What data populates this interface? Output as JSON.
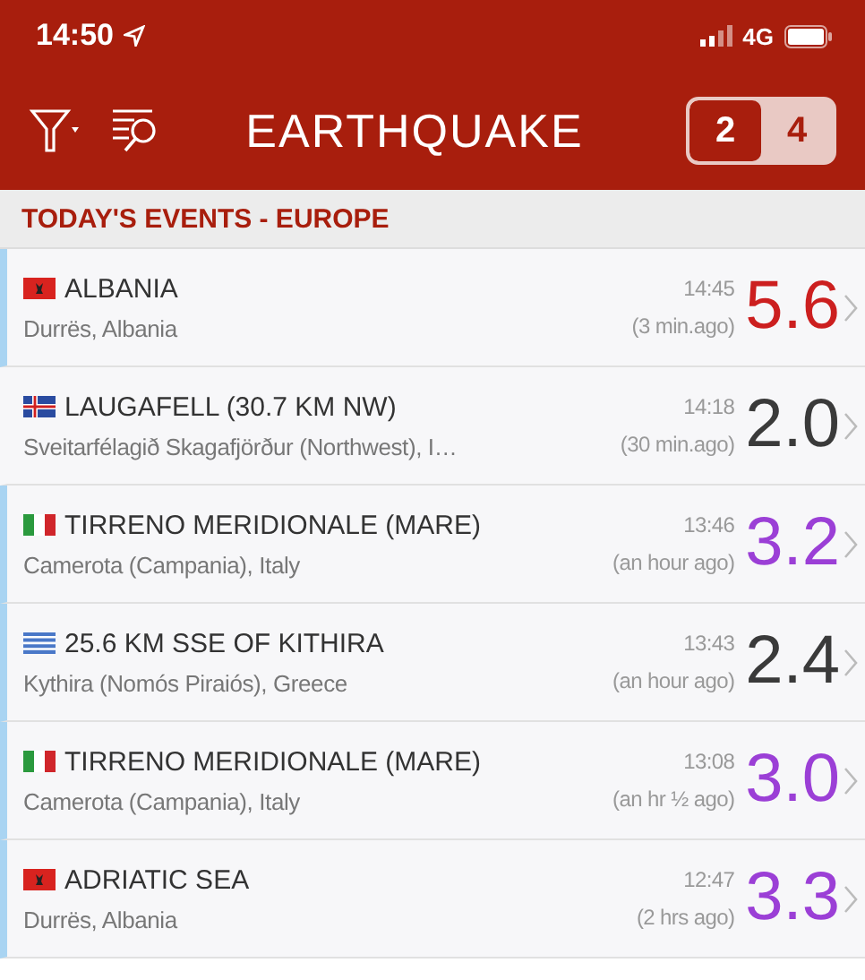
{
  "status_bar": {
    "time": "14:50",
    "network": "4G"
  },
  "header": {
    "title": "EARTHQUAKE",
    "segments": [
      {
        "label": "2",
        "selected": true
      },
      {
        "label": "4",
        "selected": false
      }
    ]
  },
  "section": {
    "title": "TODAY'S EVENTS - EUROPE"
  },
  "events": [
    {
      "kind": "albania",
      "title": "ALBANIA",
      "place": "Durrës, Albania",
      "time": "14:45",
      "ago": "(3 min.ago)",
      "magnitude": "5.6",
      "color": "#cc1f1f",
      "marked": true
    },
    {
      "kind": "iceland",
      "title": "LAUGAFELL (30.7 KM NW)",
      "place": "Sveitarfélagið Skagafjörður (Northwest), I…",
      "time": "14:18",
      "ago": "(30 min.ago)",
      "magnitude": "2.0",
      "color": "#3a3a3a",
      "marked": false
    },
    {
      "kind": "italy",
      "title": "TIRRENO MERIDIONALE (MARE)",
      "place": "Camerota (Campania), Italy",
      "time": "13:46",
      "ago": "(an hour ago)",
      "magnitude": "3.2",
      "color": "#9b3fd6",
      "marked": true
    },
    {
      "kind": "greece",
      "title": "25.6 KM SSE OF KITHIRA",
      "place": "Kythira (Nomós Piraiós), Greece",
      "time": "13:43",
      "ago": "(an hour ago)",
      "magnitude": "2.4",
      "color": "#3a3a3a",
      "marked": true
    },
    {
      "kind": "italy",
      "title": "TIRRENO MERIDIONALE (MARE)",
      "place": "Camerota (Campania), Italy",
      "time": "13:08",
      "ago": "(an hr ½ ago)",
      "magnitude": "3.0",
      "color": "#9b3fd6",
      "marked": true
    },
    {
      "kind": "albania",
      "title": "ADRIATIC SEA",
      "place": "Durrës, Albania",
      "time": "12:47",
      "ago": "(2 hrs ago)",
      "magnitude": "3.3",
      "color": "#9b3fd6",
      "marked": true
    }
  ]
}
